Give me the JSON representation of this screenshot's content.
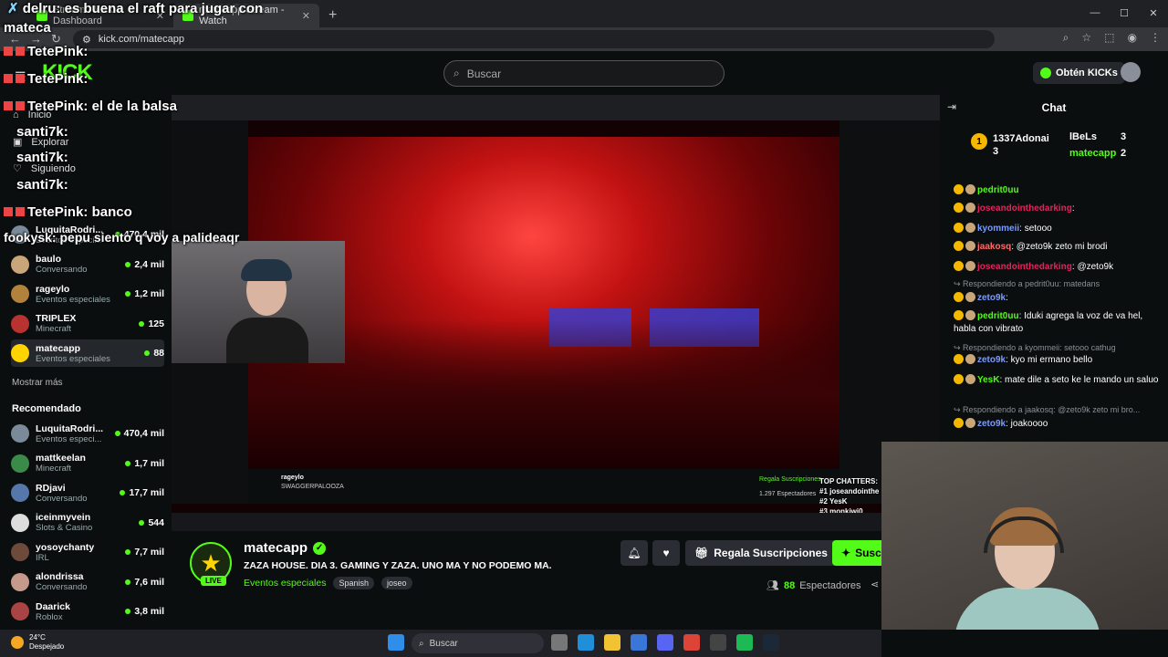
{
  "browser": {
    "tabs": [
      {
        "label": "Stream - Kick Dashboard",
        "active": false
      },
      {
        "label": "matecapp Stream - Watch",
        "active": true
      }
    ],
    "url": "kick.com/matecapp"
  },
  "header": {
    "search_placeholder": "Buscar",
    "kicks_button": "Obtén KICKs"
  },
  "sidebar": {
    "nav": [
      "Inicio",
      "Explorar",
      "Siguiendo"
    ],
    "following": [
      {
        "name": "LuquitaRodri...",
        "category": "Eventos especi...",
        "viewers": "470,4 mil",
        "color": "#7a8a99"
      },
      {
        "name": "baulo",
        "category": "Conversando",
        "viewers": "2,4 mil",
        "color": "#c9a57a"
      },
      {
        "name": "rageylo",
        "category": "Eventos especiales",
        "viewers": "1,2 mil",
        "color": "#b0823c"
      },
      {
        "name": "TRIPLEX",
        "category": "Minecraft",
        "viewers": "125",
        "color": "#b8332f"
      },
      {
        "name": "matecapp",
        "category": "Eventos especiales",
        "viewers": "88",
        "color": "#ffd400"
      }
    ],
    "show_more": "Mostrar más",
    "recommended_title": "Recomendado",
    "recommended": [
      {
        "name": "LuquitaRodri...",
        "category": "Eventos especi...",
        "viewers": "470,4 mil",
        "color": "#7a8a99"
      },
      {
        "name": "mattkeelan",
        "category": "Minecraft",
        "viewers": "1,7 mil",
        "color": "#3a8a4a"
      },
      {
        "name": "RDjavi",
        "category": "Conversando",
        "viewers": "17,7 mil",
        "color": "#5577aa"
      },
      {
        "name": "iceinmyvein",
        "category": "Slots & Casino",
        "viewers": "544",
        "color": "#dddddd"
      },
      {
        "name": "yosoychanty",
        "category": "IRL",
        "viewers": "7,7 mil",
        "color": "#6d4a3a"
      },
      {
        "name": "alondrissa",
        "category": "Conversando",
        "viewers": "7,6 mil",
        "color": "#c69a8a"
      },
      {
        "name": "Daarick",
        "category": "Roblox",
        "viewers": "3,8 mil",
        "color": "#aa4444"
      }
    ]
  },
  "overlay_chat": [
    {
      "user": "delru",
      "text": "es buena el raft para jugar con"
    },
    {
      "user": "",
      "text": "mateca"
    },
    {
      "user": "TetePink",
      "text": ""
    },
    {
      "user": "TetePink",
      "text": ""
    },
    {
      "user": "TetePink",
      "text": "el de la balsa"
    },
    {
      "user": "santi7k",
      "text": ""
    },
    {
      "user": "santi7k",
      "text": ""
    },
    {
      "user": "santi7k",
      "text": ""
    },
    {
      "user": "TetePink",
      "text": "banco"
    },
    {
      "user": "fookysk",
      "text": "pepu siento q voy a palideaqr"
    }
  ],
  "video": {
    "top_chatters_title": "TOP CHATTERS:",
    "top_chatters": [
      "#1 joseandointhe",
      "#2 YesK",
      "#3 monkiwi0"
    ],
    "inner_streamer": "rageylo",
    "inner_title": "SWAGGERPALOOZA",
    "inner_viewers": "1.297 Espectadores",
    "inner_gift": "Regala Suscripciones"
  },
  "stream": {
    "name": "matecapp",
    "live": "LIVE",
    "title": "ZAZA HOUSE. DIA 3. GAMING Y ZAZA. UNO MA Y NO PODEMO MA.",
    "category": "Eventos especiales",
    "tags": [
      "Spanish",
      "joseo"
    ],
    "gift_button": "Regala Suscripciones",
    "subscribe_button": "Susc",
    "viewer_count": "88",
    "viewer_label": "Espectadores"
  },
  "chat": {
    "title": "Chat",
    "leaderboard": [
      {
        "rank": "1",
        "name": "1337Adonai",
        "count": "3"
      },
      {
        "rank": "",
        "name": "lBeLs",
        "count": "3"
      },
      {
        "rank": "",
        "name": "matecapp",
        "count": "2"
      }
    ],
    "messages": [
      {
        "kind": "msg",
        "user": "pedrit0uu",
        "color": "#53fc18",
        "text": ""
      },
      {
        "kind": "msg",
        "user": "joseandointhedarking",
        "color": "#e0245e",
        "text": ":"
      },
      {
        "kind": "msg",
        "user": "kyommeii",
        "color": "#7b9cff",
        "text": ": setooo"
      },
      {
        "kind": "msg",
        "user": "jaakosq",
        "color": "#ff6b6b",
        "text": ": @zeto9k zeto mi brodi"
      },
      {
        "kind": "msg",
        "user": "joseandointhedarking",
        "color": "#e0245e",
        "text": ": @zeto9k"
      },
      {
        "kind": "reply",
        "text": "Respondiendo a pedrit0uu: matedans"
      },
      {
        "kind": "msg",
        "user": "zeto9k",
        "color": "#7b9cff",
        "text": ":"
      },
      {
        "kind": "msg",
        "user": "pedrit0uu",
        "color": "#53fc18",
        "text": ": Iduki agrega la voz de va hel, habla con vibrato"
      },
      {
        "kind": "reply",
        "text": "Respondiendo a kyommeii: setooo cathug"
      },
      {
        "kind": "msg",
        "user": "zeto9k",
        "color": "#7b9cff",
        "text": ": kyo mi ermano bello"
      },
      {
        "kind": "msg",
        "user": "YesK",
        "color": "#53fc18",
        "text": ": mate dile a seto ke le mando un saluo"
      },
      {
        "kind": "reply",
        "text": "Respondiendo a jaakosq: @zeto9k zeto mi bro..."
      },
      {
        "kind": "msg",
        "user": "zeto9k",
        "color": "#7b9cff",
        "text": ": joakoooo"
      }
    ]
  },
  "taskbar": {
    "temperature": "24°C",
    "weather": "Despejado",
    "search": "Buscar"
  }
}
